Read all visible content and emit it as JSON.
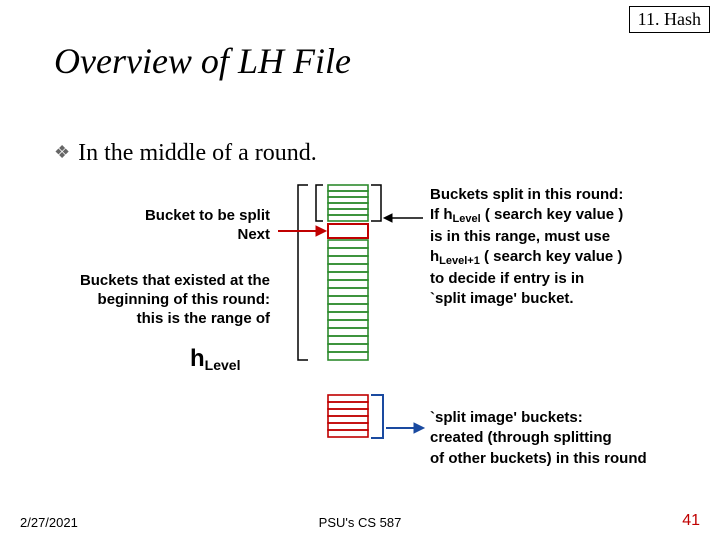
{
  "chapter_tag": "11. Hash",
  "title": "Overview of LH File",
  "bullet": "In the middle of a round.",
  "left": {
    "label1_line1": "Bucket to be split",
    "label1_line2": "Next",
    "label2_line1": "Buckets that existed at the",
    "label2_line2": "beginning of this round:",
    "label2_line3": "this is the range of",
    "hlevel_h": "h",
    "hlevel_sub": "Level"
  },
  "right1": {
    "l1": "Buckets split in this round:",
    "l2a": "If ",
    "l2h": "h",
    "l2sub": "Level",
    "l2b": "  ( search key value )",
    "l3": "is in this range, must use",
    "l4h": "h",
    "l4sub": "Level+1",
    "l4b": " ( search key value )",
    "l5": "to decide if entry is in",
    "l6": "`split image' bucket."
  },
  "right2": {
    "l1": "`split image' buckets:",
    "l2": "created (through splitting",
    "l3": "of other buckets) in this round"
  },
  "footer": {
    "date": "2/27/2021",
    "course": "PSU's CS 587",
    "page": "41"
  },
  "colors": {
    "green": "#2e8b2e",
    "red": "#c00000",
    "blue": "#1a4aa0"
  }
}
